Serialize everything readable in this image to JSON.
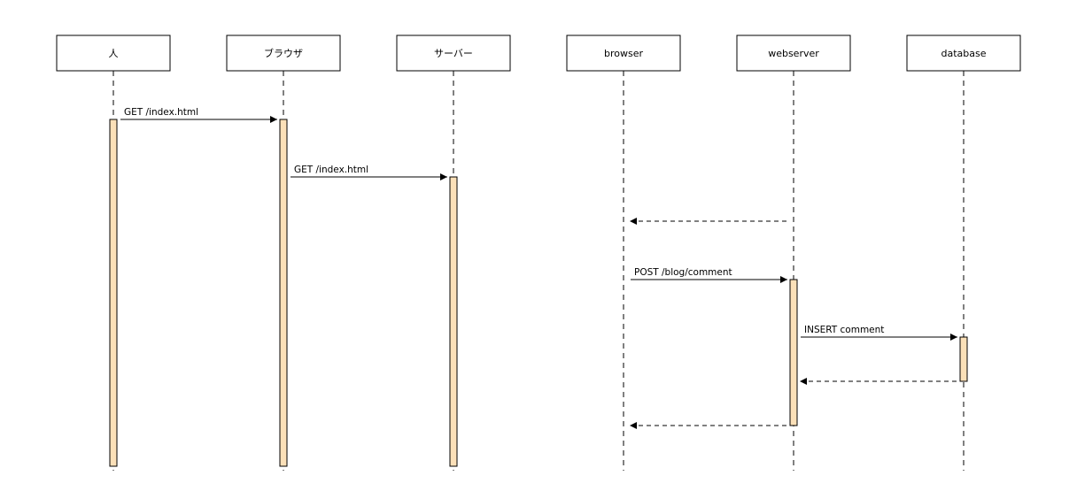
{
  "diagrams": [
    {
      "participants": [
        {
          "id": "hito",
          "label": "人"
        },
        {
          "id": "browser_ja",
          "label": "ブラウザ"
        },
        {
          "id": "server_ja",
          "label": "サーバー"
        }
      ],
      "messages": [
        {
          "from": "hito",
          "to": "browser_ja",
          "label": "GET /index.html",
          "style": "solid"
        },
        {
          "from": "browser_ja",
          "to": "server_ja",
          "label": "GET /index.html",
          "style": "solid"
        }
      ]
    },
    {
      "participants": [
        {
          "id": "browser",
          "label": "browser"
        },
        {
          "id": "webserver",
          "label": "webserver"
        },
        {
          "id": "database",
          "label": "database"
        }
      ],
      "messages": [
        {
          "from": "webserver",
          "to": "browser",
          "label": "",
          "style": "dashed"
        },
        {
          "from": "browser",
          "to": "webserver",
          "label": "POST /blog/comment",
          "style": "solid"
        },
        {
          "from": "webserver",
          "to": "database",
          "label": "INSERT comment",
          "style": "solid"
        },
        {
          "from": "database",
          "to": "webserver",
          "label": "",
          "style": "dashed"
        },
        {
          "from": "webserver",
          "to": "browser",
          "label": "",
          "style": "dashed"
        }
      ]
    }
  ],
  "colors": {
    "activation_fill": "#fbe0b8",
    "line": "#000000",
    "box_fill": "#ffffff"
  }
}
